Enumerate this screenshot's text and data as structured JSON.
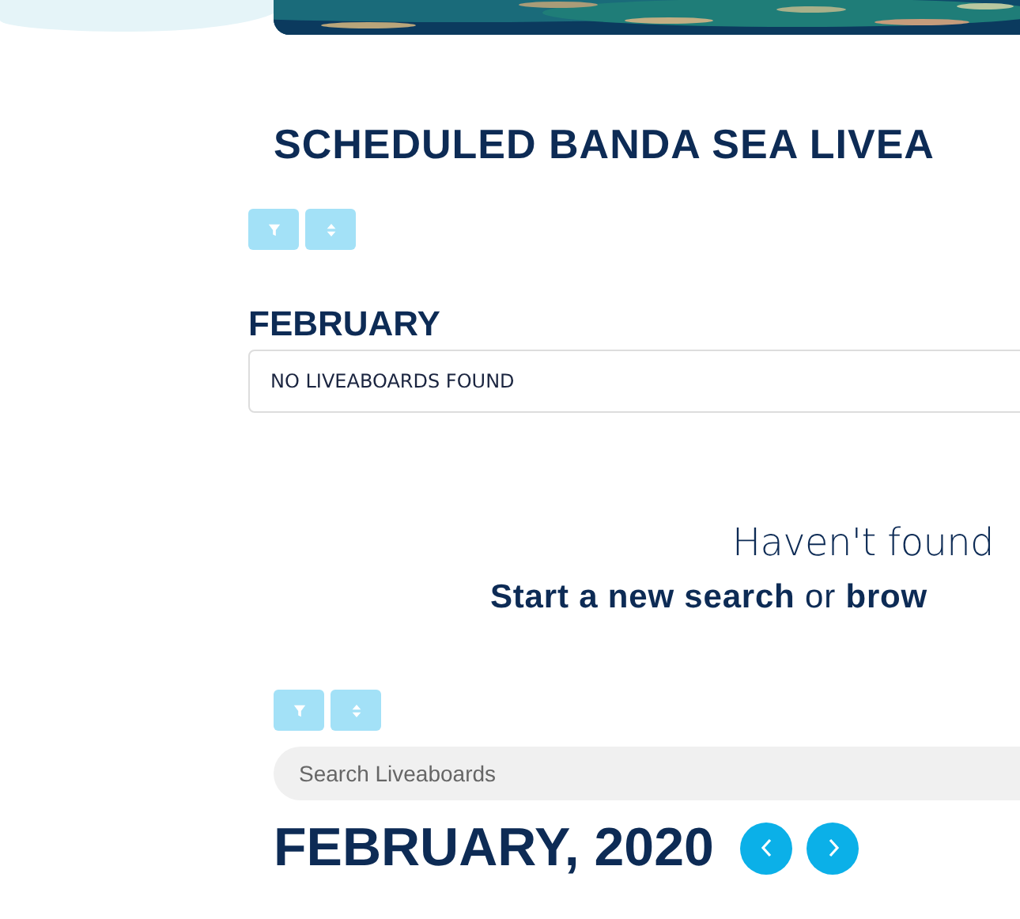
{
  "title": "SCHEDULED BANDA SEA LIVEA",
  "month_group": {
    "heading": "FEBRUARY",
    "message": "NO LIVEABOARDS FOUND"
  },
  "prompt": {
    "question": "Haven't found",
    "actions": "**Start a new search** or **brow**"
  },
  "search": {
    "placeholder": "Search Liveaboards"
  },
  "calendar": {
    "heading": "FEBRUARY, 2020"
  }
}
